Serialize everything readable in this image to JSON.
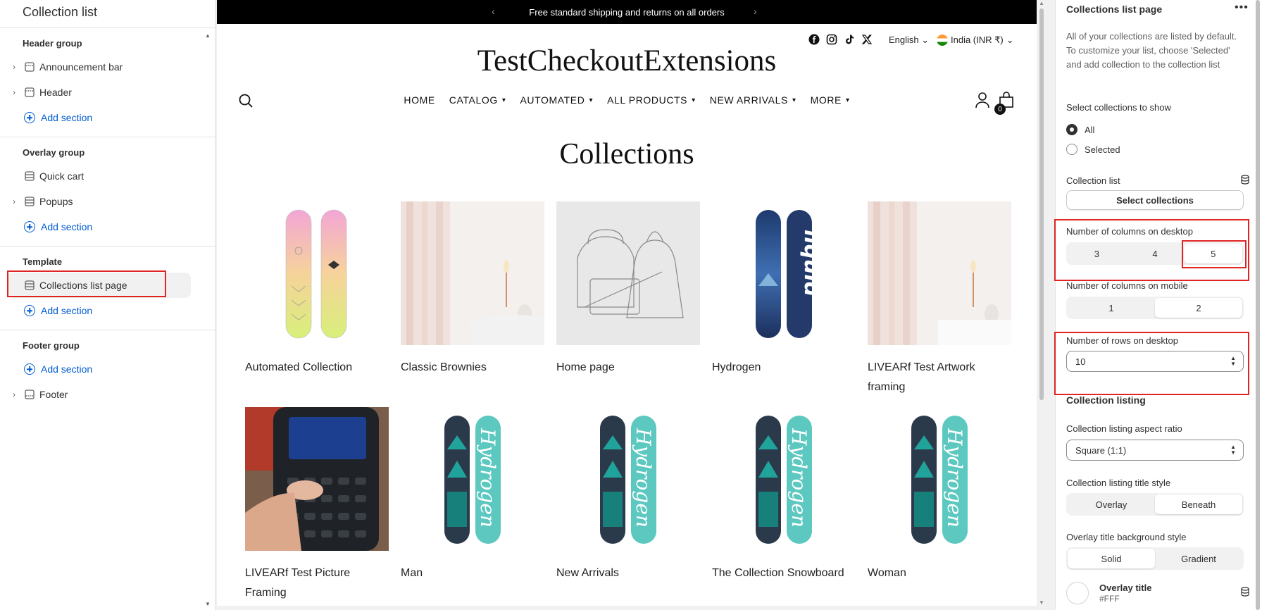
{
  "sidebar": {
    "title": "Collection list",
    "groups": [
      {
        "title": "Header group",
        "items": [
          {
            "label": "Announcement bar"
          },
          {
            "label": "Header"
          }
        ],
        "add_label": "Add section"
      },
      {
        "title": "Overlay group",
        "items": [
          {
            "label": "Quick cart"
          },
          {
            "label": "Popups"
          }
        ],
        "add_label": "Add section"
      },
      {
        "title": "Template",
        "items": [
          {
            "label": "Collections list page"
          }
        ],
        "add_label": "Add section"
      },
      {
        "title": "Footer group",
        "add_label": "Add section",
        "items": [
          {
            "label": "Footer"
          }
        ]
      }
    ]
  },
  "store": {
    "announcement": "Free standard shipping and returns on all orders",
    "brand": "TestCheckoutExtensions",
    "language": "English",
    "country": "India (INR ₹)",
    "cart_count": "0",
    "nav": [
      "HOME",
      "CATALOG",
      "AUTOMATED",
      "ALL PRODUCTS",
      "NEW ARRIVALS",
      "MORE"
    ],
    "page_title": "Collections",
    "collections": [
      {
        "name": "Automated Collection",
        "image": "pink-yellow-snowboard"
      },
      {
        "name": "Classic Brownies",
        "image": "bedroom-lamp-photo"
      },
      {
        "name": "Home page",
        "image": "bags-line-drawing"
      },
      {
        "name": "Hydrogen",
        "image": "liquid-blue-snowboard"
      },
      {
        "name": "LIVEARf Test Artwork framing",
        "image": "bedroom-lamp-photo"
      },
      {
        "name": "LIVEARf Test Picture Framing",
        "image": "calculator-photo"
      },
      {
        "name": "Man",
        "image": "hydrogen-teal-snowboard"
      },
      {
        "name": "New Arrivals",
        "image": "hydrogen-teal-snowboard"
      },
      {
        "name": "The Collection Snowboard",
        "image": "hydrogen-teal-snowboard"
      },
      {
        "name": "Woman",
        "image": "hydrogen-teal-snowboard"
      }
    ]
  },
  "settings": {
    "title": "Collections list page",
    "description": "All of your collections are listed by default. To customize your list, choose 'Selected' and add collection to the collection list",
    "select_label": "Select collections to show",
    "radio": [
      "All",
      "Selected"
    ],
    "radio_selected": "All",
    "collection_list_label": "Collection list",
    "select_button": "Select collections",
    "cols_desktop_label": "Number of columns on desktop",
    "cols_desktop": [
      "3",
      "4",
      "5"
    ],
    "cols_desktop_selected": "5",
    "cols_mobile_label": "Number of columns on mobile",
    "cols_mobile": [
      "1",
      "2"
    ],
    "cols_mobile_selected": "2",
    "rows_desktop_label": "Number of rows on desktop",
    "rows_desktop_value": "10",
    "listing_heading": "Collection listing",
    "aspect_label": "Collection listing aspect ratio",
    "aspect_value": "Square (1:1)",
    "title_style_label": "Collection listing title style",
    "title_style": [
      "Overlay",
      "Beneath"
    ],
    "title_style_selected": "Beneath",
    "overlay_bg_label": "Overlay title background style",
    "overlay_bg": [
      "Solid",
      "Gradient"
    ],
    "overlay_bg_selected": "Solid",
    "overlay_title_label": "Overlay title",
    "overlay_title_value": "#FFF"
  },
  "colors": {
    "accent": "#005bd3",
    "highlight": "#e02424",
    "announcement_bg": "#000000",
    "swatch": "#FFFFFF"
  }
}
